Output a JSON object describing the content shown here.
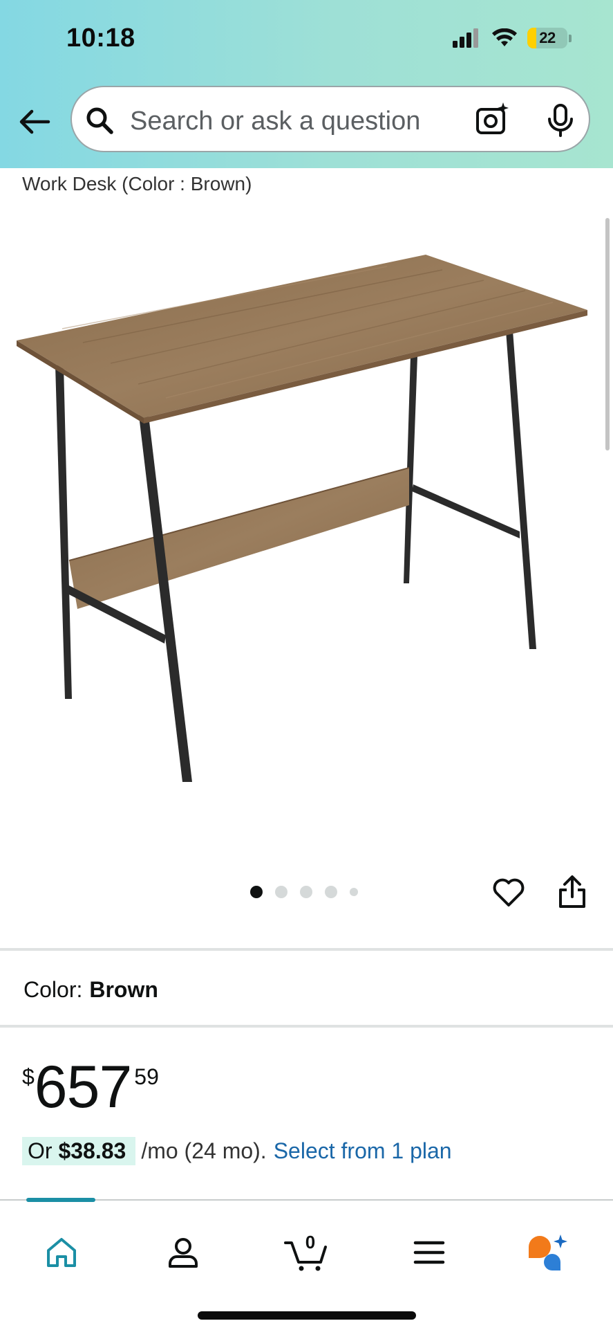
{
  "status_bar": {
    "time": "10:18",
    "battery": "22"
  },
  "header": {
    "search_placeholder": "Search or ask a question"
  },
  "product": {
    "title": "Work Desk (Color : Brown)",
    "gallery": {
      "image_count": 5,
      "active_index": 0
    },
    "color": {
      "label": "Color:",
      "value": "Brown"
    },
    "price": {
      "symbol": "$",
      "whole": "657",
      "fraction": "59"
    },
    "installment": {
      "prefix": "Or",
      "amount": "$38.83",
      "terms": "/mo (24 mo).",
      "link": "Select from 1 plan"
    }
  },
  "bottom_nav": {
    "cart_count": "0",
    "items": [
      "home-icon",
      "account-icon",
      "cart-icon",
      "menu-icon",
      "rufus-icon"
    ],
    "active": "home-icon"
  },
  "colors": {
    "accent": "#1b8fa5",
    "link": "#1a67a8",
    "chip": "#d9f5ee",
    "battery": "#ffd000"
  }
}
